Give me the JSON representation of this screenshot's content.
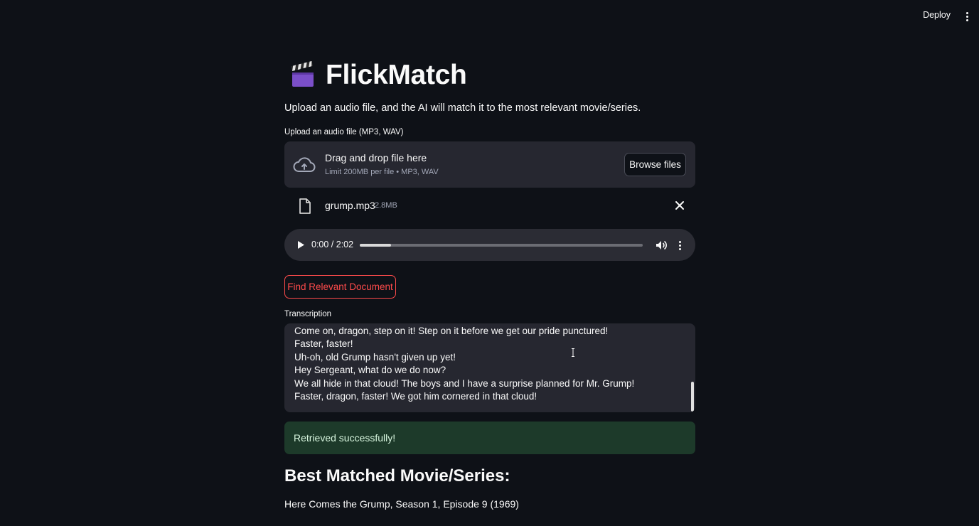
{
  "topbar": {
    "deploy_label": "Deploy"
  },
  "app": {
    "title": "FlickMatch",
    "subtitle": "Upload an audio file, and the AI will match it to the most relevant movie/series."
  },
  "uploader": {
    "label": "Upload an audio file (MP3, WAV)",
    "dropzone_text": "Drag and drop file here",
    "limit_text": "Limit 200MB per file • MP3, WAV",
    "browse_label": "Browse files",
    "file": {
      "name": "grump.mp3",
      "size": "2.8MB"
    }
  },
  "audio_player": {
    "time": "0:00 / 2:02",
    "buffered_fraction": 0.11
  },
  "find_button_label": "Find Relevant Document",
  "transcription": {
    "label": "Transcription",
    "lines": [
      "Come on, dragon, step on it! Step on it before we get our pride punctured!",
      "Faster, faster!",
      "Uh-oh, old Grump hasn't given up yet!",
      "Hey Sergeant, what do we do now?",
      "We all hide in that cloud! The boys and I have a surprise planned for Mr. Grump!",
      "Faster, dragon, faster! We got him cornered in that cloud!"
    ]
  },
  "status": {
    "message": "Retrieved successfully!"
  },
  "result": {
    "heading": "Best Matched Movie/Series:",
    "match": "Here Comes the Grump, Season 1, Episode 9 (1969)"
  },
  "colors": {
    "background": "#0e1117",
    "accent": "#ff4b4b",
    "success_bg": "#1d3a2a"
  }
}
